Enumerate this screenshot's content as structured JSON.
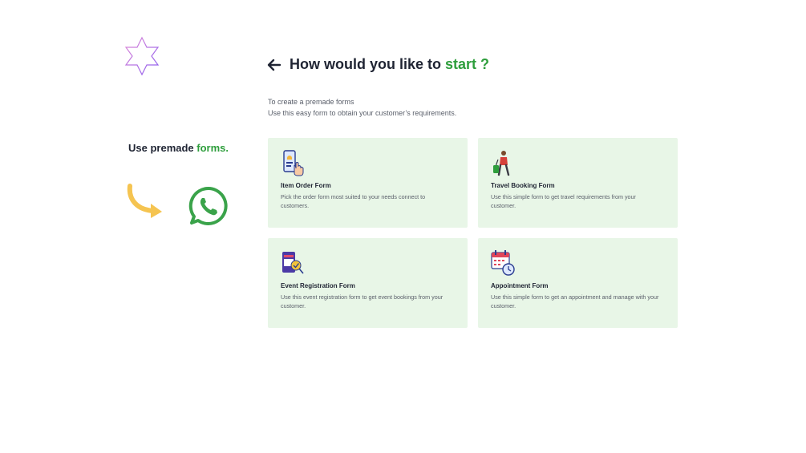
{
  "heading": {
    "prefix": "How would you like to ",
    "accent": "start ?"
  },
  "intro": {
    "line1": "To create a premade forms",
    "line2": "Use this easy form to obtain your customer’s requirements."
  },
  "side": {
    "prefix": "Use premade ",
    "accent": "forms."
  },
  "cards": [
    {
      "title": "Item Order Form",
      "desc": "Pick the order form most suited to your needs connect to customers."
    },
    {
      "title": "Travel Booking Form",
      "desc": "Use this simple form to get travel requirements from your customer."
    },
    {
      "title": "Event Registration Form",
      "desc": "Use this event registration form to get event bookings from your customer."
    },
    {
      "title": "Appointment Form",
      "desc": "Use this simple form to get an appointment and manage with your customer."
    }
  ],
  "colors": {
    "accent": "#2e9e3c",
    "card_bg": "#e8f6e7",
    "whatsapp": "#3aa34a",
    "arrow": "#f5c451"
  }
}
